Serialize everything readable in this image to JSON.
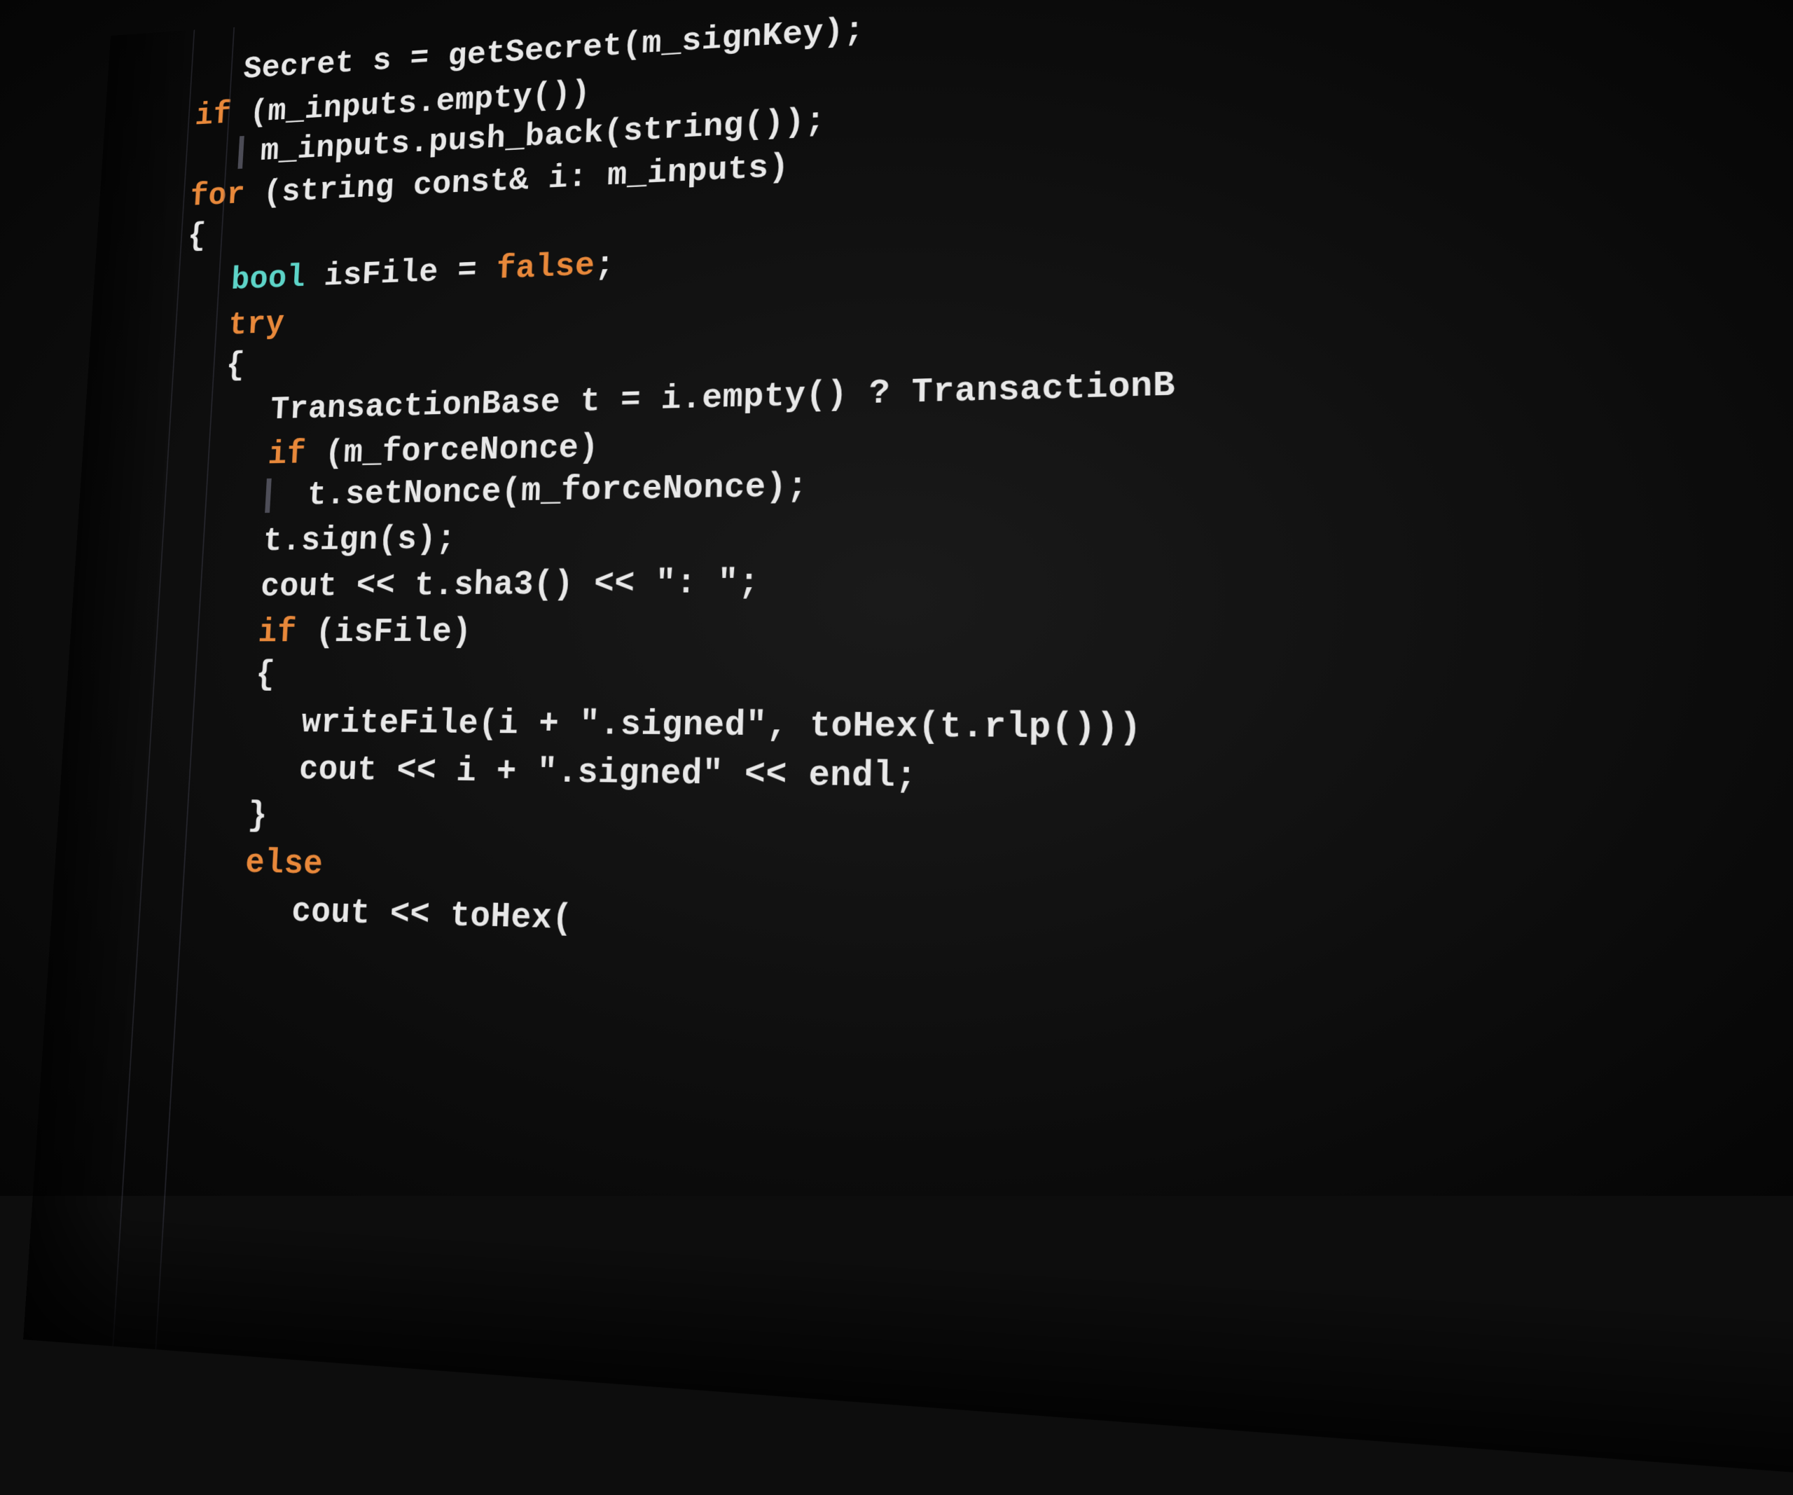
{
  "code": {
    "lines": [
      {
        "id": "line1",
        "indent": 1,
        "parts": [
          {
            "text": "Secret s = getSecret(m_signKey);",
            "color": "white"
          }
        ]
      },
      {
        "id": "line2",
        "indent": 0,
        "parts": [
          {
            "text": "if",
            "color": "orange"
          },
          {
            "text": " (m_inputs.empty())",
            "color": "white"
          }
        ]
      },
      {
        "id": "line3",
        "indent": 1,
        "vbar": true,
        "parts": [
          {
            "text": "    m_inputs.push_back(string());",
            "color": "white"
          }
        ]
      },
      {
        "id": "line4",
        "indent": 0,
        "parts": [
          {
            "text": "for",
            "color": "orange"
          },
          {
            "text": " (string const& i: m_inputs)",
            "color": "white"
          }
        ]
      },
      {
        "id": "line5",
        "indent": 0,
        "parts": [
          {
            "text": "{",
            "color": "white"
          }
        ]
      },
      {
        "id": "line6",
        "indent": 1,
        "parts": [
          {
            "text": "bool",
            "color": "cyan"
          },
          {
            "text": " isFile = ",
            "color": "white"
          },
          {
            "text": "false",
            "color": "orange"
          },
          {
            "text": ";",
            "color": "white"
          }
        ]
      },
      {
        "id": "line7",
        "indent": 1,
        "parts": [
          {
            "text": "try",
            "color": "orange"
          }
        ]
      },
      {
        "id": "line8",
        "indent": 1,
        "parts": [
          {
            "text": "{",
            "color": "white"
          }
        ]
      },
      {
        "id": "line9",
        "indent": 2,
        "parts": [
          {
            "text": "TransactionBase t = i.empty() ? ",
            "color": "white"
          },
          {
            "text": "TransactionB",
            "color": "white",
            "truncated": true
          }
        ]
      },
      {
        "id": "line10",
        "indent": 2,
        "parts": [
          {
            "text": "if",
            "color": "orange"
          },
          {
            "text": " (m_forceNonce)",
            "color": "white"
          }
        ]
      },
      {
        "id": "line11",
        "indent": 2,
        "vbar": true,
        "parts": [
          {
            "text": "    t.setNonce(m_forceNonce);",
            "color": "white"
          }
        ]
      },
      {
        "id": "line12",
        "indent": 2,
        "parts": [
          {
            "text": "t.sign(s);",
            "color": "white"
          }
        ]
      },
      {
        "id": "line13",
        "indent": 2,
        "parts": [
          {
            "text": "cout << t.sha3() << \": \";",
            "color": "white"
          }
        ]
      },
      {
        "id": "line14",
        "indent": 2,
        "parts": [
          {
            "text": "if",
            "color": "orange"
          },
          {
            "text": " (isFile)",
            "color": "white"
          }
        ]
      },
      {
        "id": "line15",
        "indent": 2,
        "parts": [
          {
            "text": "{",
            "color": "white"
          }
        ]
      },
      {
        "id": "line16",
        "indent": 3,
        "parts": [
          {
            "text": "writeFile(i + \".signed\",",
            "color": "white"
          },
          {
            "text": " toHex(t.rlp()))",
            "color": "white",
            "truncated": true
          }
        ]
      },
      {
        "id": "line17",
        "indent": 3,
        "parts": [
          {
            "text": "cout << i + \".signed\" <<",
            "color": "white"
          },
          {
            "text": " endl;",
            "color": "white",
            "truncated": true
          }
        ]
      },
      {
        "id": "line18",
        "indent": 2,
        "parts": [
          {
            "text": "}",
            "color": "white"
          }
        ]
      },
      {
        "id": "line19",
        "indent": 2,
        "parts": [
          {
            "text": "else",
            "color": "orange"
          }
        ]
      },
      {
        "id": "line20",
        "indent": 3,
        "parts": [
          {
            "text": "cout <<",
            "color": "white"
          },
          {
            "text": " toHex(",
            "color": "white",
            "truncated": true
          }
        ]
      }
    ]
  }
}
